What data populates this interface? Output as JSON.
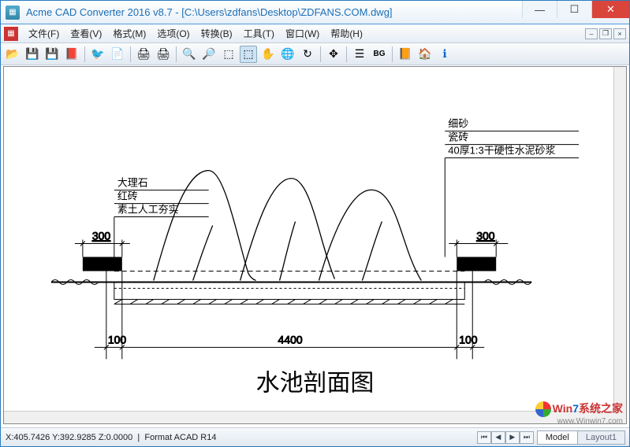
{
  "title": "Acme CAD Converter 2016 v8.7 - [C:\\Users\\zdfans\\Desktop\\ZDFANS.COM.dwg]",
  "menus": {
    "file": "文件(F)",
    "view": "查看(V)",
    "format": "格式(M)",
    "options": "选项(O)",
    "convert": "转换(B)",
    "tools": "工具(T)",
    "window": "窗口(W)",
    "help": "帮助(H)"
  },
  "toolbar": {
    "open": "📂",
    "save": "💾",
    "savered": "💾",
    "pdf": "📕",
    "bird": "🕊",
    "convert": "📄",
    "print": "🖨",
    "print2": "🖨",
    "zoomin": "🔍+",
    "zoomout": "🔍−",
    "zoomwin": "🔲",
    "zoomsel": "⬚",
    "pan": "✋",
    "globe": "🌐",
    "rotate": "↻",
    "arrows": "✥",
    "layers": "☰",
    "bg_label": "BG",
    "book": "📙",
    "home": "🏠",
    "info": "ℹ"
  },
  "drawing": {
    "left_labels": [
      "大理石",
      "红砖",
      "素土人工夯实"
    ],
    "right_labels": [
      "细砂",
      "瓷砖",
      "40厚1:3干硬性水泥砂浆"
    ],
    "dim_left_top": "300",
    "dim_right_top": "300",
    "dim_left_bottom": "100",
    "dim_mid_bottom": "4400",
    "dim_right_bottom": "100",
    "title": "水池剖面图"
  },
  "status": {
    "coords": "X:405.7426 Y:392.9285 Z:0.0000",
    "format": "Format ACAD R14"
  },
  "tabs": {
    "model": "Model",
    "layout1": "Layout1"
  },
  "watermark": {
    "brand_pre": "Win",
    "brand_num": "7",
    "brand_suf": "系统之家",
    "url": "www.Winwin7.com"
  }
}
